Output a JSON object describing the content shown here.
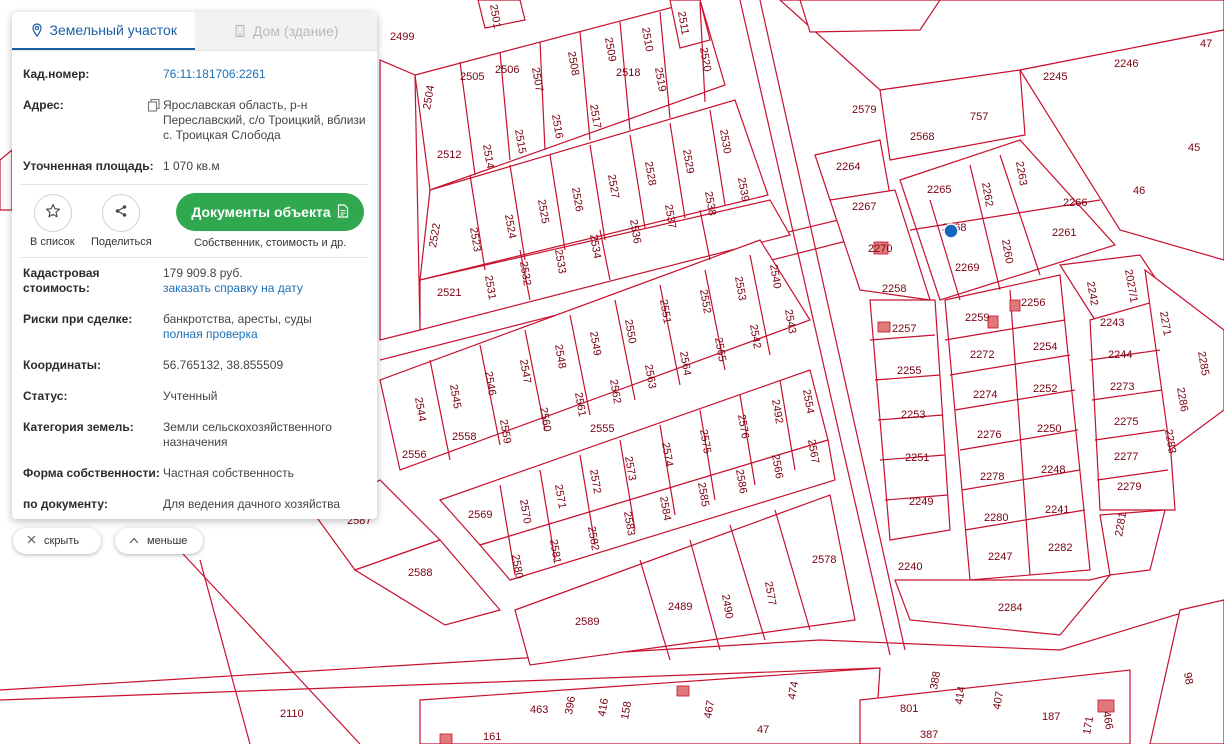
{
  "tabs": {
    "land": "Земельный участок",
    "house": "Дом (здание)"
  },
  "info": {
    "cadnum_label": "Кад.номер:",
    "cadnum_value": "76:11:181706:2261",
    "address_label": "Адрес:",
    "address_value": "Ярославская область, р-н Переславский, с/о Троицкий, вблизи с. Троицкая Слобода",
    "area_label": "Уточненная площадь:",
    "area_value": "1 070 кв.м"
  },
  "actions": {
    "favorite": "В список",
    "share": "Поделиться",
    "documents": "Документы объекта",
    "documents_sub": "Собственник, стоимость и др."
  },
  "details": {
    "cost_label": "Кадастровая стоимость:",
    "cost_value": "179 909.8 руб.",
    "cost_link": "заказать справку на дату",
    "risks_label": "Риски при сделке:",
    "risks_value": "банкротства, аресты, суды",
    "risks_link": "полная проверка",
    "coords_label": "Координаты:",
    "coords_value": "56.765132, 38.855509",
    "status_label": "Статус:",
    "status_value": "Учтенный",
    "category_label": "Категория земель:",
    "category_value": "Земли сельскохозяйственного назначения",
    "ownership_label": "Форма собственности:",
    "ownership_value": "Частная собственность",
    "usage_label": "по документу:",
    "usage_value": "Для ведения дачного хозяйства"
  },
  "controls": {
    "hide": "скрыть",
    "less": "меньше"
  },
  "colors": {
    "parcel_line": "#c8102e",
    "accent": "#1d5fa6",
    "button": "#2fa84f",
    "marker": "#1565c0"
  },
  "map": {
    "parcel_labels": [
      "2499",
      "2501",
      "2511",
      "2505",
      "2506",
      "2507",
      "2508",
      "2509",
      "2510",
      "2520",
      "2518",
      "2519",
      "2517",
      "2516",
      "2515",
      "2514",
      "2504",
      "2512",
      "2530",
      "2529",
      "2528",
      "2527",
      "2526",
      "2525",
      "2524",
      "2523",
      "2522",
      "2521",
      "2531",
      "2532",
      "2533",
      "2534",
      "2536",
      "2537",
      "2538",
      "2539",
      "2540",
      "2553",
      "2552",
      "2551",
      "2550",
      "2549",
      "2548",
      "2547",
      "2546",
      "2545",
      "2544",
      "2543",
      "2542",
      "2565",
      "2564",
      "2563",
      "2562",
      "2561",
      "2560",
      "2559",
      "2558",
      "2556",
      "2555",
      "2554",
      "2492",
      "2576",
      "2575",
      "2574",
      "2573",
      "2572",
      "2571",
      "2570",
      "2569",
      "2567",
      "2566",
      "2586",
      "2585",
      "2584",
      "2583",
      "2582",
      "2581",
      "2580",
      "2578",
      "2577",
      "2490",
      "2489",
      "2589",
      "2588",
      "2587",
      "2579",
      "2568",
      "757",
      "2264",
      "2265",
      "2262",
      "2263",
      "2266",
      "2267",
      "2268",
      "2260",
      "2261",
      "2270",
      "2269",
      "2258",
      "2259",
      "2256",
      "2257",
      "2272",
      "2254",
      "2255",
      "2274",
      "2252",
      "2253",
      "2276",
      "2250",
      "2251",
      "2278",
      "2248",
      "2249",
      "2280",
      "2241",
      "2247",
      "2282",
      "2240",
      "2284",
      "2242",
      "2027/1",
      "2271",
      "2243",
      "2244",
      "2273",
      "2275",
      "2277",
      "2279",
      "2281",
      "2283",
      "2285",
      "2286",
      "2245",
      "2246",
      "45",
      "46",
      "47",
      "2110",
      "463",
      "396",
      "416",
      "158",
      "467",
      "47",
      "474",
      "388",
      "414",
      "407",
      "187",
      "466",
      "98",
      "801",
      "387",
      "161",
      "171"
    ]
  }
}
